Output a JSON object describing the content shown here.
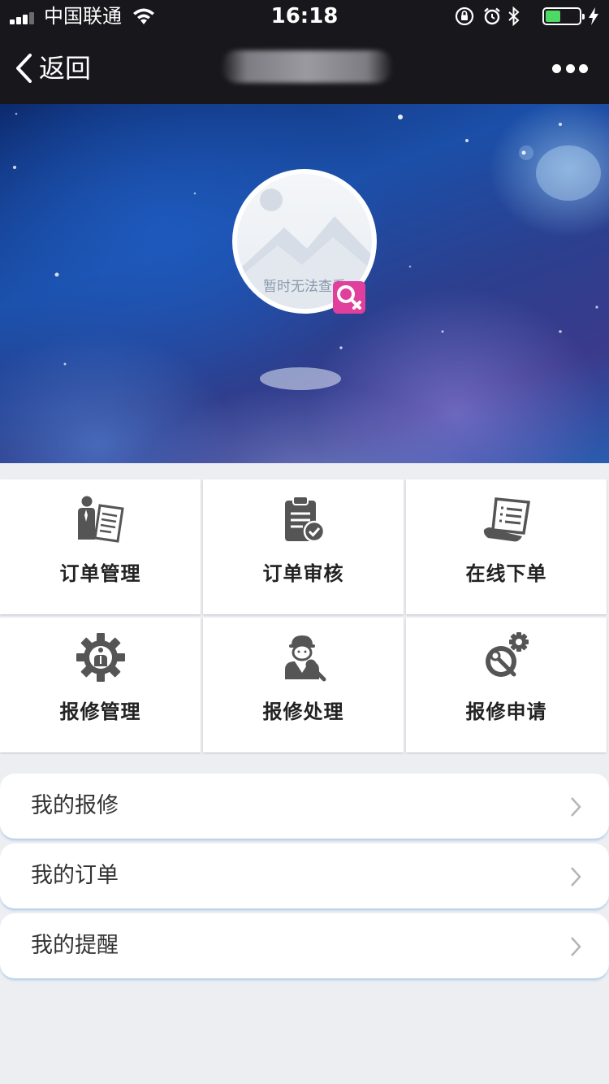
{
  "status_bar": {
    "carrier": "中国联通",
    "time": "16:18",
    "battery_level": 0.45
  },
  "nav": {
    "back_label": "返回"
  },
  "profile": {
    "avatar_placeholder_text": "暂时无法查看"
  },
  "grid": {
    "items": [
      {
        "label": "订单管理",
        "icon": "order-management-icon"
      },
      {
        "label": "订单审核",
        "icon": "order-review-icon"
      },
      {
        "label": "在线下单",
        "icon": "online-order-icon"
      },
      {
        "label": "报修管理",
        "icon": "repair-management-icon"
      },
      {
        "label": "报修处理",
        "icon": "repair-handling-icon"
      },
      {
        "label": "报修申请",
        "icon": "repair-request-icon"
      }
    ]
  },
  "list": {
    "items": [
      {
        "label": "我的报修"
      },
      {
        "label": "我的订单"
      },
      {
        "label": "我的提醒"
      }
    ]
  },
  "colors": {
    "nav_background": "#18181c",
    "badge": "#e0409b",
    "icon_gray": "#555555",
    "page_background": "#eceef2"
  }
}
